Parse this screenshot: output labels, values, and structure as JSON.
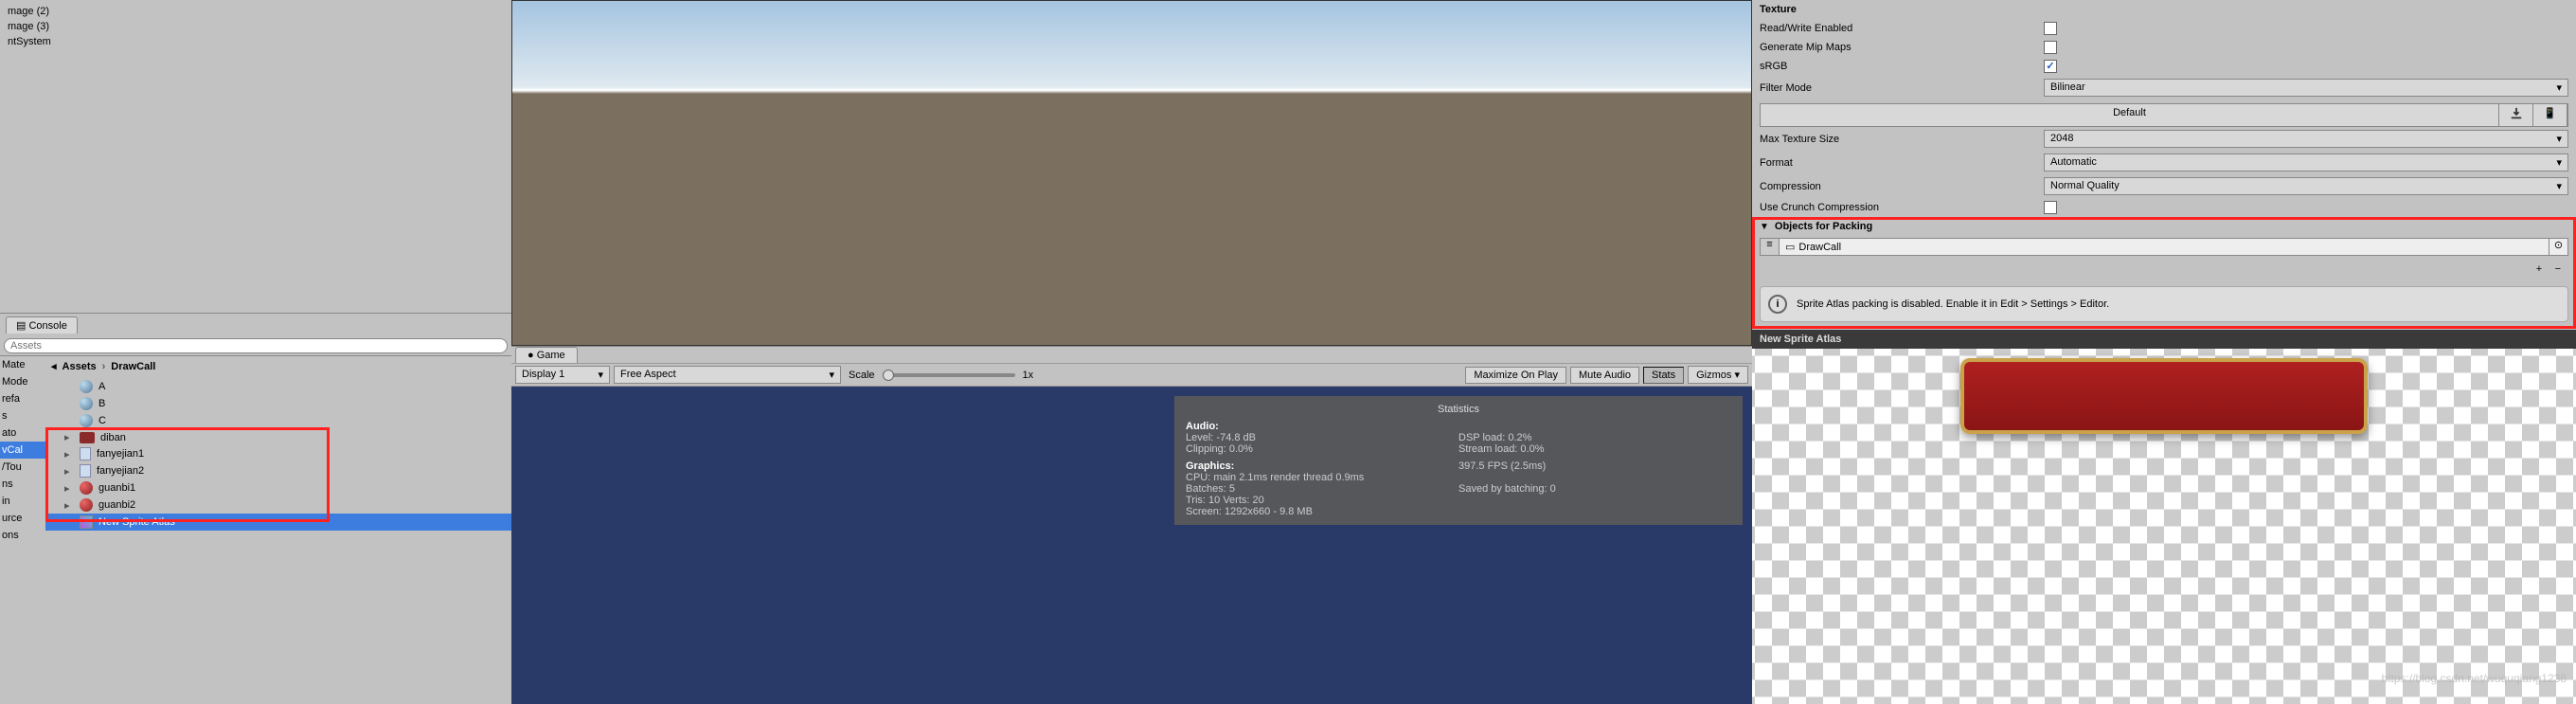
{
  "hierarchy": {
    "items": [
      "mage (2)",
      "mage (3)",
      "ntSystem"
    ]
  },
  "console": {
    "tab_label": "Console"
  },
  "left_cut_labels": [
    "Mate",
    "Mode",
    "refa",
    "s",
    "ato",
    "vCal",
    "/Tou",
    "ns",
    "in",
    "urce",
    "ons"
  ],
  "left_cut_selected_index": 5,
  "project": {
    "breadcrumb_root": "Assets",
    "breadcrumb_folder": "DrawCall",
    "items": [
      {
        "label": "A",
        "icon": "sphere",
        "expandable": false
      },
      {
        "label": "B",
        "icon": "sphere",
        "expandable": false
      },
      {
        "label": "C",
        "icon": "sphere",
        "expandable": false
      },
      {
        "label": "diban",
        "icon": "red",
        "expandable": true
      },
      {
        "label": "fanyejian1",
        "icon": "pref",
        "expandable": true
      },
      {
        "label": "fanyejian2",
        "icon": "pref",
        "expandable": true
      },
      {
        "label": "guanbi1",
        "icon": "redball",
        "expandable": true
      },
      {
        "label": "guanbi2",
        "icon": "redball",
        "expandable": true
      },
      {
        "label": "New Sprite Atlas",
        "icon": "atlas",
        "expandable": false,
        "selected": true
      }
    ]
  },
  "game": {
    "tab_label": "Game",
    "display": "Display 1",
    "aspect": "Free Aspect",
    "scale_label": "Scale",
    "scale_value": "1x",
    "maximize": "Maximize On Play",
    "mute": "Mute Audio",
    "stats": "Stats",
    "gizmos": "Gizmos"
  },
  "stats_panel": {
    "title": "Statistics",
    "audio_head": "Audio:",
    "audio_level": "Level: -74.8 dB",
    "audio_dsp": "DSP load: 0.2%",
    "audio_clip": "Clipping: 0.0%",
    "audio_stream": "Stream load: 0.0%",
    "gfx_head": "Graphics:",
    "fps": "397.5 FPS (2.5ms)",
    "cpu": "CPU: main 2.1ms  render thread 0.9ms",
    "batches": "Batches: 5",
    "saved": "Saved by batching: 0",
    "tris": "Tris: 10   Verts: 20",
    "screen": "Screen: 1292x660 - 9.8 MB"
  },
  "inspector": {
    "texture_head": "Texture",
    "rw_label": "Read/Write Enabled",
    "mip_label": "Generate Mip Maps",
    "srgb_label": "sRGB",
    "filter_label": "Filter Mode",
    "filter_value": "Bilinear",
    "default_tab": "Default",
    "maxsize_label": "Max Texture Size",
    "maxsize_value": "2048",
    "format_label": "Format",
    "format_value": "Automatic",
    "compression_label": "Compression",
    "compression_value": "Normal Quality",
    "crunch_label": "Use Crunch Compression",
    "packing_head": "Objects for Packing",
    "packing_item": "DrawCall",
    "info_msg": "Sprite Atlas packing is disabled. Enable it in Edit > Settings > Editor.",
    "preview_title": "New Sprite Atlas"
  },
  "watermark": "https://blog.csdn.net/wuquqiang1238"
}
